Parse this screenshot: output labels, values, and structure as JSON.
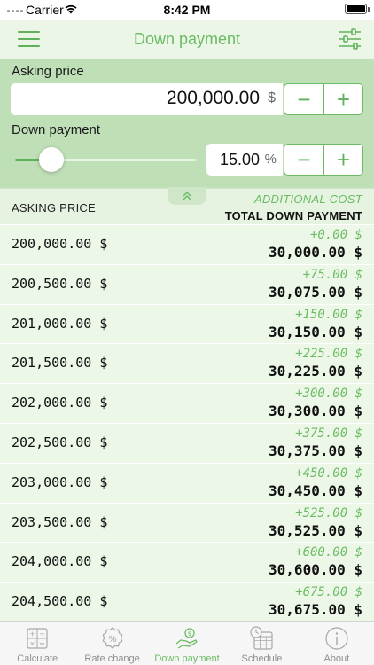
{
  "status_bar": {
    "carrier": "Carrier",
    "time": "8:42 PM"
  },
  "nav": {
    "title": "Down payment",
    "left_icon": "menu-icon",
    "right_icon": "sliders-icon"
  },
  "inputs": {
    "asking_price_label": "Asking price",
    "asking_price_value": "200,000.00",
    "asking_price_unit": "$",
    "down_payment_label": "Down payment",
    "down_payment_value": "15.00",
    "down_payment_unit": "%",
    "slider_fraction": 0.2,
    "minus": "−",
    "plus": "+"
  },
  "table": {
    "col_left": "ASKING PRICE",
    "col_right_top": "ADDITIONAL COST",
    "col_right_bottom": "TOTAL DOWN PAYMENT",
    "rows": [
      {
        "price": "200,000.00 $",
        "additional": "+0.00 $",
        "total": "30,000.00 $"
      },
      {
        "price": "200,500.00 $",
        "additional": "+75.00 $",
        "total": "30,075.00 $"
      },
      {
        "price": "201,000.00 $",
        "additional": "+150.00 $",
        "total": "30,150.00 $"
      },
      {
        "price": "201,500.00 $",
        "additional": "+225.00 $",
        "total": "30,225.00 $"
      },
      {
        "price": "202,000.00 $",
        "additional": "+300.00 $",
        "total": "30,300.00 $"
      },
      {
        "price": "202,500.00 $",
        "additional": "+375.00 $",
        "total": "30,375.00 $"
      },
      {
        "price": "203,000.00 $",
        "additional": "+450.00 $",
        "total": "30,450.00 $"
      },
      {
        "price": "203,500.00 $",
        "additional": "+525.00 $",
        "total": "30,525.00 $"
      },
      {
        "price": "204,000.00 $",
        "additional": "+600.00 $",
        "total": "30,600.00 $"
      },
      {
        "price": "204,500.00 $",
        "additional": "+675.00 $",
        "total": "30,675.00 $"
      }
    ]
  },
  "tabs": [
    {
      "label": "Calculate",
      "icon": "calculator-icon",
      "active": false
    },
    {
      "label": "Rate change",
      "icon": "percent-badge-icon",
      "active": false
    },
    {
      "label": "Down payment",
      "icon": "hand-money-icon",
      "active": true
    },
    {
      "label": "Schedule",
      "icon": "calendar-clock-icon",
      "active": false
    },
    {
      "label": "About",
      "icon": "info-icon",
      "active": false
    }
  ],
  "colors": {
    "accent": "#6abb63",
    "panel": "#bfdfb7",
    "row": "#ecf7e8"
  }
}
